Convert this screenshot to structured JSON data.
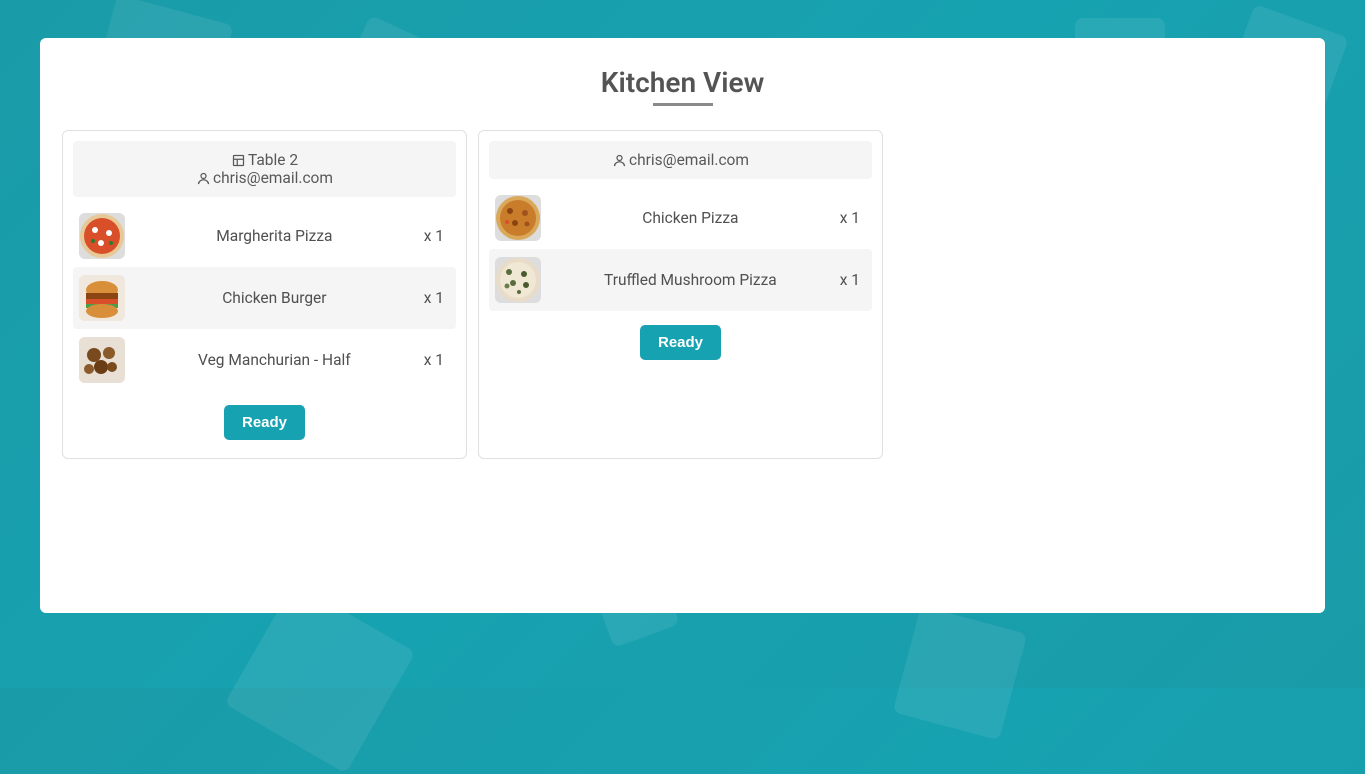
{
  "page_title": "Kitchen View",
  "ready_label": "Ready",
  "orders": [
    {
      "table": "Table 2",
      "customer": "chris@email.com",
      "items": [
        {
          "name": "Margherita Pizza",
          "qty": "x 1",
          "img": "pizza1"
        },
        {
          "name": "Chicken Burger",
          "qty": "x 1",
          "img": "burger"
        },
        {
          "name": "Veg Manchurian - Half",
          "qty": "x 1",
          "img": "manchurian"
        }
      ]
    },
    {
      "table": null,
      "customer": "chris@email.com",
      "items": [
        {
          "name": "Chicken Pizza",
          "qty": "x 1",
          "img": "pizza2"
        },
        {
          "name": "Truffled Mushroom Pizza",
          "qty": "x 1",
          "img": "pizza3"
        }
      ]
    }
  ]
}
